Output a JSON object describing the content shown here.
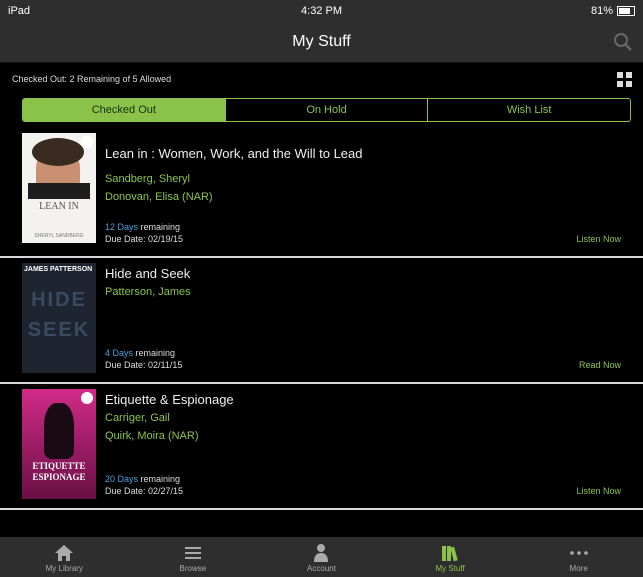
{
  "status": {
    "device": "iPad",
    "time": "4:32 PM",
    "battery": "81%"
  },
  "nav": {
    "title": "My Stuff"
  },
  "summary": "Checked Out: 2 Remaining of 5 Allowed",
  "segments": [
    "Checked Out",
    "On Hold",
    "Wish List"
  ],
  "books": [
    {
      "title": "Lean in : Women, Work, and the Will to Lead",
      "authors": [
        "Sandberg, Sheryl",
        "Donovan, Elisa (NAR)"
      ],
      "days": "12 Days",
      "remaining_word": "remaining",
      "due": "Due Date: 02/19/15",
      "action": "Listen Now",
      "cover_text": "LEAN IN",
      "cover_author": "SHERYL SANDBERG"
    },
    {
      "title": "Hide and Seek",
      "authors": [
        "Patterson, James"
      ],
      "days": "4 Days",
      "remaining_word": "remaining",
      "due": "Due Date: 02/11/15",
      "action": "Read Now",
      "cover_text": "JAMES PATTERSON",
      "cover_title": "HIDE SEEK"
    },
    {
      "title": "Etiquette & Espionage",
      "authors": [
        "Carriger, Gail",
        "Quirk, Moira (NAR)"
      ],
      "days": "20 Days",
      "remaining_word": "remaining",
      "due": "Due Date: 02/27/15",
      "action": "Listen Now",
      "cover_text": "ETIQUETTE ESPIONAGE"
    }
  ],
  "tabs": [
    {
      "label": "My Library",
      "icon": "home-icon"
    },
    {
      "label": "Browse",
      "icon": "list-icon"
    },
    {
      "label": "Account",
      "icon": "person-icon"
    },
    {
      "label": "My Stuff",
      "icon": "books-icon"
    },
    {
      "label": "More",
      "icon": "more-icon"
    }
  ],
  "colors": {
    "accent": "#8bc34a",
    "days": "#4aa0e0",
    "bar": "#2e2e2e"
  }
}
